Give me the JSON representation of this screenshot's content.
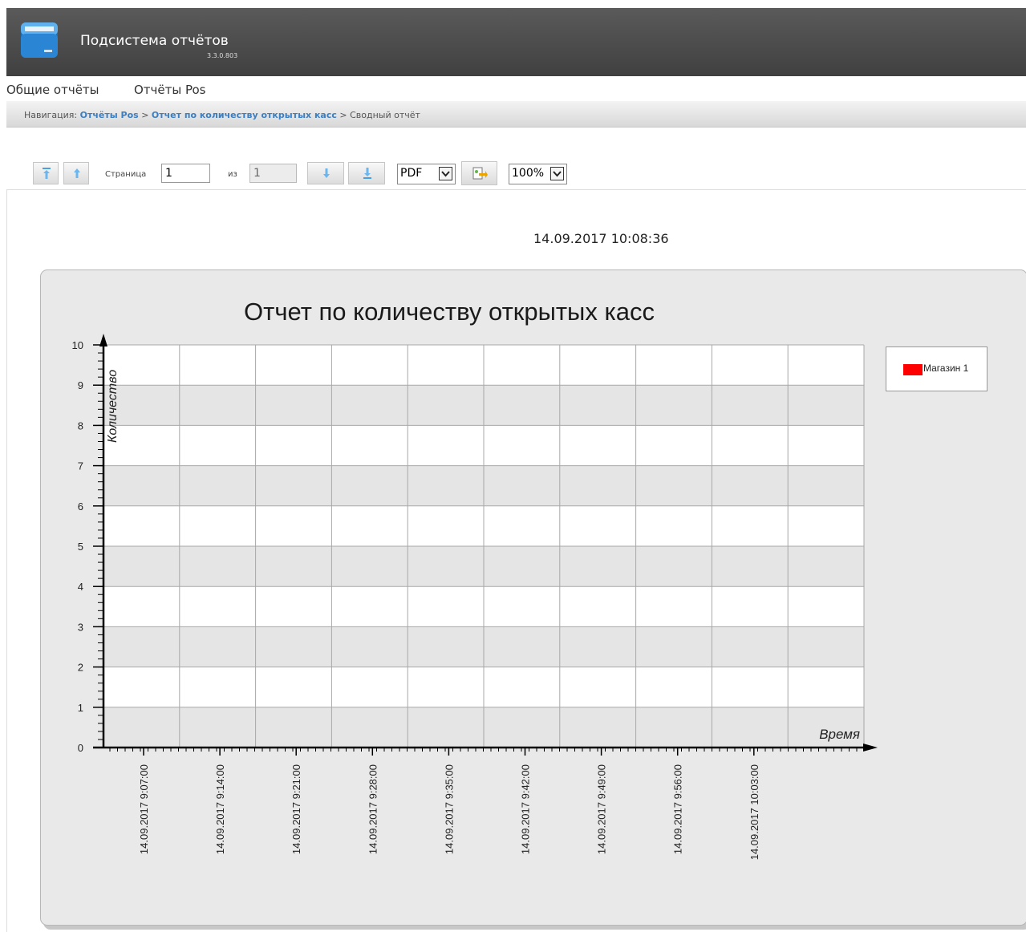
{
  "app": {
    "title": "Подсистема отчётов",
    "version": "3.3.0.803"
  },
  "menu": {
    "items": [
      "Общие отчёты",
      "Отчёты Pos"
    ]
  },
  "breadcrumb": {
    "prefix": "Навигация:",
    "links": [
      "Отчёты Pos",
      "Отчет по количеству открытых касс"
    ],
    "separator": ">",
    "current": "Сводный отчёт"
  },
  "toolbar": {
    "page_label": "Страница",
    "page_value": "1",
    "of_label": "из",
    "total_pages": "1",
    "export_format": "PDF",
    "zoom": "100%"
  },
  "report": {
    "timestamp": "14.09.2017 10:08:36"
  },
  "chart_data": {
    "type": "bar",
    "title": "Отчет по количеству открытых касс",
    "xlabel": "Время",
    "ylabel": "Количество",
    "ylim": [
      0,
      10
    ],
    "yticks": [
      0,
      1,
      2,
      3,
      4,
      5,
      6,
      7,
      8,
      9,
      10
    ],
    "categories": [
      "14.09.2017 9:07:00",
      "14.09.2017 9:14:00",
      "14.09.2017 9:21:00",
      "14.09.2017 9:28:00",
      "14.09.2017 9:35:00",
      "14.09.2017 9:42:00",
      "14.09.2017 9:49:00",
      "14.09.2017 9:56:00",
      "14.09.2017 10:03:00"
    ],
    "series": [
      {
        "name": "Магазин 1",
        "color": "#ff0000",
        "values": [
          0,
          0,
          0,
          0,
          0,
          0,
          0,
          0,
          0
        ]
      }
    ],
    "grid": true,
    "legend_position": "right"
  }
}
